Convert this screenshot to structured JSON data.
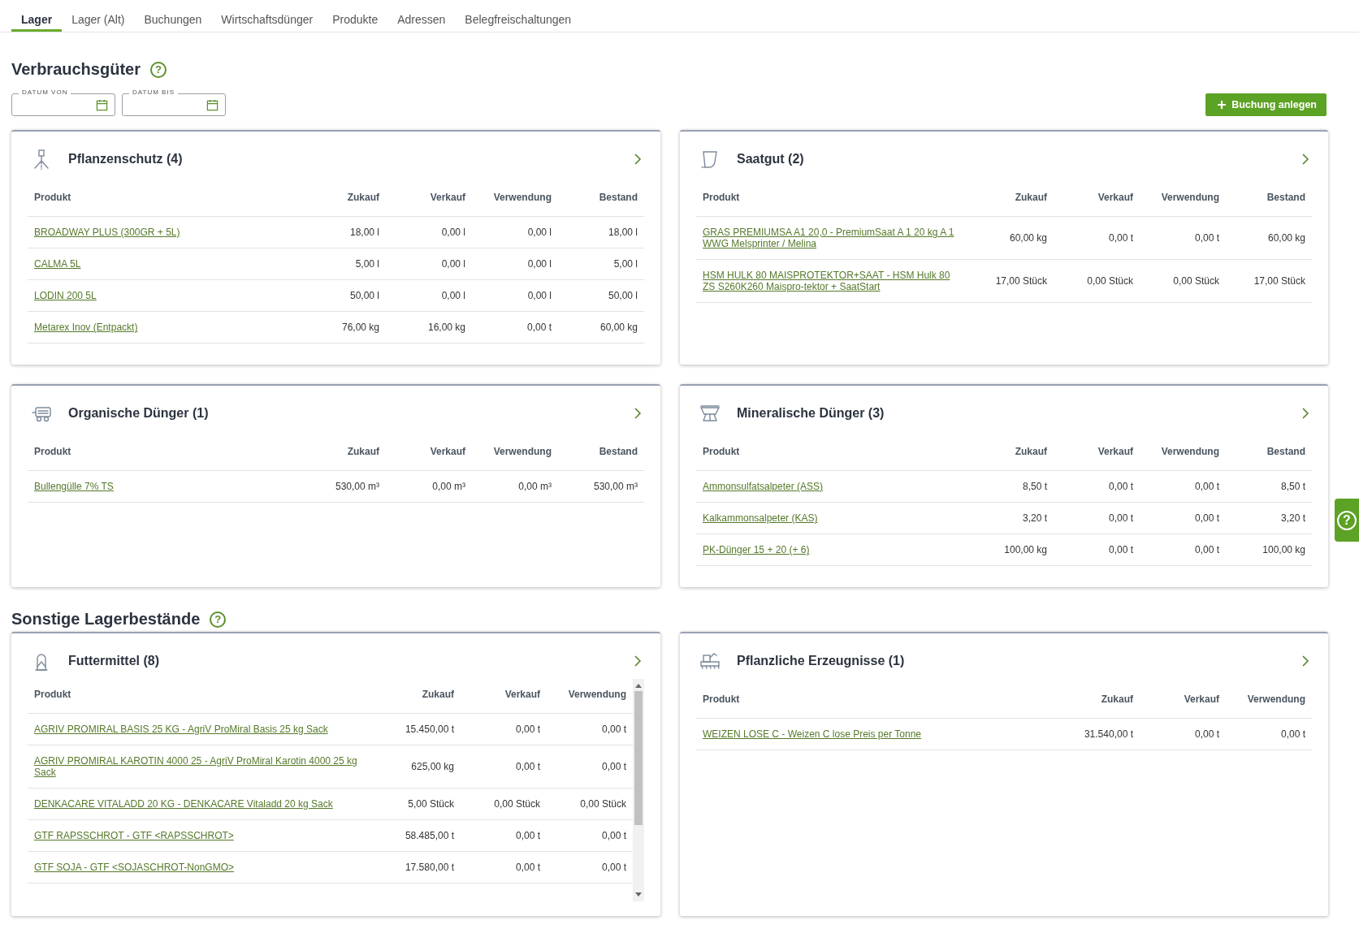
{
  "tabs": [
    {
      "label": "Lager",
      "selected": true
    },
    {
      "label": "Lager (Alt)",
      "selected": false
    },
    {
      "label": "Buchungen",
      "selected": false
    },
    {
      "label": "Wirtschaftsdünger",
      "selected": false
    },
    {
      "label": "Produkte",
      "selected": false
    },
    {
      "label": "Adressen",
      "selected": false
    },
    {
      "label": "Belegfreischaltungen",
      "selected": false
    }
  ],
  "sections": [
    {
      "title": "Verbrauchsgüter",
      "help": "?",
      "date_filters": [
        {
          "label": "DATUM VON"
        },
        {
          "label": "DATUM BIS"
        }
      ],
      "action": {
        "label": "Buchung anlegen"
      },
      "cards": [
        {
          "title": "Pflanzenschutz (4)",
          "kind": "sprayer",
          "scrollable": false,
          "columns": [
            "Produkt",
            "Zukauf",
            "Verkauf",
            "Verwendung",
            "Bestand"
          ],
          "rows": [
            {
              "product": "BROADWAY PLUS (300GR + 5L)",
              "values": [
                "18,00 l",
                "0,00 l",
                "0,00 l",
                "18,00 l"
              ]
            },
            {
              "product": "CALMA 5L",
              "values": [
                "5,00 l",
                "0,00 l",
                "0,00 l",
                "5,00 l"
              ]
            },
            {
              "product": "LODIN 200 5L",
              "values": [
                "50,00 l",
                "0,00 l",
                "0,00 l",
                "50,00 l"
              ]
            },
            {
              "product": "Metarex Inov (Entpackt)",
              "values": [
                "76,00 kg",
                "16,00 kg",
                "0,00 t",
                "60,00 kg"
              ]
            }
          ]
        },
        {
          "title": "Saatgut (2)",
          "kind": "seed-bag",
          "scrollable": false,
          "columns": [
            "Produkt",
            "Zukauf",
            "Verkauf",
            "Verwendung",
            "Bestand"
          ],
          "rows": [
            {
              "product": "GRAS PREMIUMSA A1 20,0 - PremiumSaat A 1 20 kg A 1 WWG Melsprinter / Melina",
              "values": [
                "60,00 kg",
                "0,00 t",
                "0,00 t",
                "60,00 kg"
              ]
            },
            {
              "product": "HSM HULK 80 MAISPROTEKTOR+SAAT - HSM Hulk 80 ZS S260K260 Maispro-tektor + SaatStart",
              "values": [
                "17,00 Stück",
                "0,00 Stück",
                "0,00 Stück",
                "17,00 Stück"
              ]
            }
          ]
        },
        {
          "title": "Organische Dünger (1)",
          "kind": "manure-spreader",
          "scrollable": false,
          "columns": [
            "Produkt",
            "Zukauf",
            "Verkauf",
            "Verwendung",
            "Bestand"
          ],
          "rows": [
            {
              "product": "Bullengülle 7% TS",
              "values": [
                "530,00 m³",
                "0,00 m³",
                "0,00 m³",
                "530,00 m³"
              ]
            }
          ]
        },
        {
          "title": "Mineralische Dünger (3)",
          "kind": "fertilizer-spreader",
          "scrollable": false,
          "columns": [
            "Produkt",
            "Zukauf",
            "Verkauf",
            "Verwendung",
            "Bestand"
          ],
          "rows": [
            {
              "product": "Ammonsulfatsalpeter (ASS)",
              "values": [
                "8,50 t",
                "0,00 t",
                "0,00 t",
                "8,50 t"
              ]
            },
            {
              "product": "Kalkammonsalpeter (KAS)",
              "values": [
                "3,20 t",
                "0,00 t",
                "0,00 t",
                "3,20 t"
              ]
            },
            {
              "product": "PK-Dünger 15 + 20 (+ 6)",
              "values": [
                "100,00 kg",
                "0,00 t",
                "0,00 t",
                "100,00 kg"
              ]
            }
          ]
        }
      ]
    },
    {
      "title": "Sonstige Lagerbestände",
      "help": "?",
      "cards": [
        {
          "title": "Futtermittel (8)",
          "kind": "silo",
          "scrollable": true,
          "columns": [
            "Produkt",
            "Zukauf",
            "Verkauf",
            "Verwendung"
          ],
          "rows": [
            {
              "product": "AGRIV PROMIRAL BASIS 25 KG - AgriV ProMiral Basis 25 kg Sack",
              "values": [
                "15.450,00 t",
                "0,00 t",
                "0,00 t"
              ]
            },
            {
              "product": "AGRIV PROMIRAL KAROTIN 4000 25 - AgriV ProMiral Karotin 4000 25 kg Sack",
              "values": [
                "625,00 kg",
                "0,00 t",
                "0,00 t"
              ]
            },
            {
              "product": "DENKACARE VITALADD 20 KG - DENKACARE Vitaladd 20 kg Sack",
              "values": [
                "5,00 Stück",
                "0,00 Stück",
                "0,00 Stück"
              ]
            },
            {
              "product": "GTF RAPSSCHROT - GTF <RAPSSCHROT>",
              "values": [
                "58.485,00 t",
                "0,00 t",
                "0,00 t"
              ]
            },
            {
              "product": "GTF SOJA - GTF <SOJASCHROT-NonGMO>",
              "values": [
                "17.580,00 t",
                "0,00 t",
                "0,00 t"
              ]
            }
          ]
        },
        {
          "title": "Pflanzliche Erzeugnisse (1)",
          "kind": "harvester",
          "scrollable": false,
          "columns": [
            "Produkt",
            "Zukauf",
            "Verkauf",
            "Verwendung"
          ],
          "rows": [
            {
              "product": "WEIZEN LOSE C - Weizen C lose Preis per Tonne",
              "values": [
                "31.540,00 t",
                "0,00 t",
                "0,00 t"
              ]
            }
          ]
        }
      ]
    }
  ],
  "help_tab": {
    "label": "?"
  }
}
